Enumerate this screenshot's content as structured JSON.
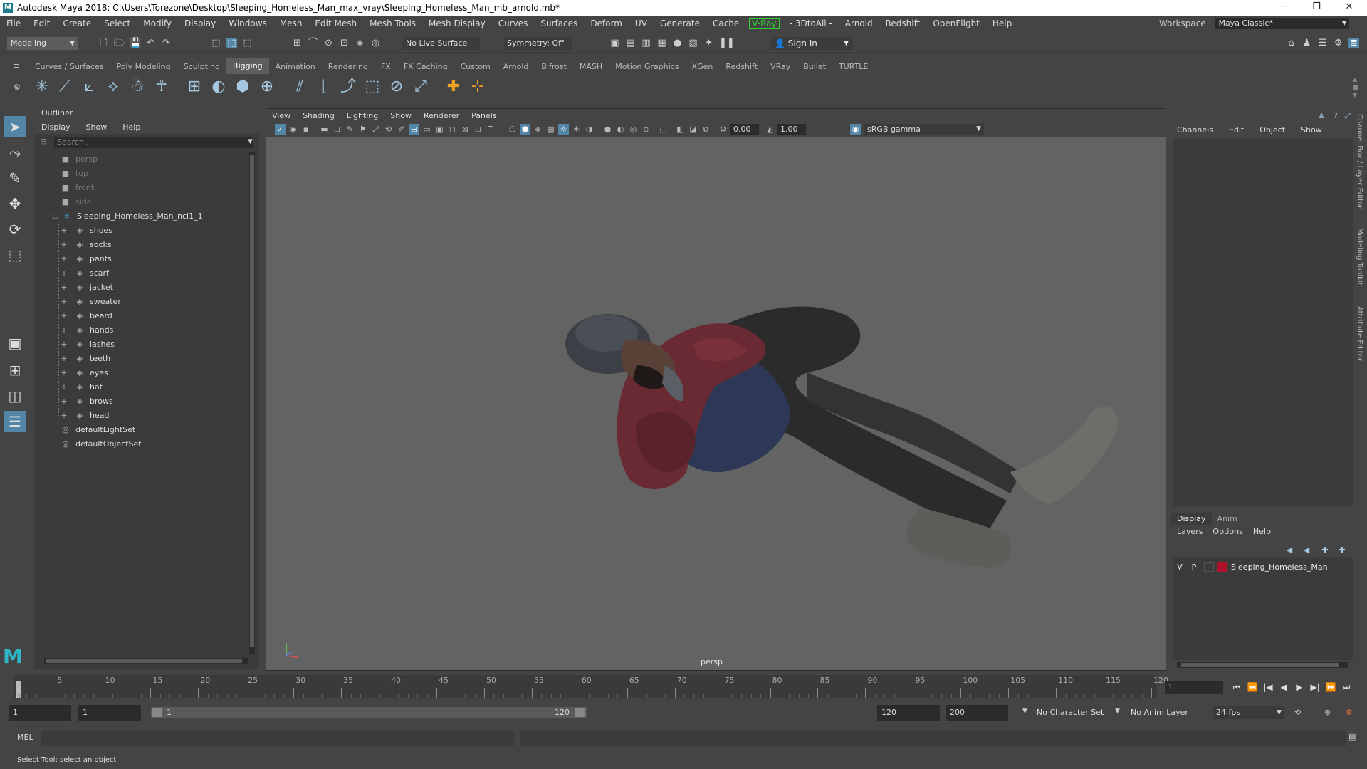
{
  "titlebar": {
    "title": "Autodesk Maya 2018: C:\\Users\\Torezone\\Desktop\\Sleeping_Homeless_Man_max_vray\\Sleeping_Homeless_Man_mb_arnold.mb*",
    "minimize": "─",
    "maximize": "❐",
    "close": "✕"
  },
  "menubar": {
    "items": [
      "File",
      "Edit",
      "Create",
      "Select",
      "Modify",
      "Display",
      "Windows",
      "Mesh",
      "Edit Mesh",
      "Mesh Tools",
      "Mesh Display",
      "Curves",
      "Surfaces",
      "Deform",
      "UV",
      "Generate",
      "Cache",
      "V-Ray",
      "- 3DtoAll -",
      "Arnold",
      "Redshift",
      "OpenFlight",
      "Help"
    ],
    "workspace_label": "Workspace :",
    "workspace_value": "Maya Classic*"
  },
  "statusline": {
    "mode": "Modeling",
    "live_surface": "No Live Surface",
    "symmetry": "Symmetry: Off",
    "sign_in": "Sign In"
  },
  "shelf": {
    "tabs": [
      "Curves / Surfaces",
      "Poly Modeling",
      "Sculpting",
      "Rigging",
      "Animation",
      "Rendering",
      "FX",
      "FX Caching",
      "Custom",
      "Arnold",
      "Bifrost",
      "MASH",
      "Motion Graphics",
      "XGen",
      "Redshift",
      "VRay",
      "Bullet",
      "TURTLE"
    ],
    "active_tab": "Rigging",
    "icon_names": [
      "joint-tool-icon",
      "ik-handle-icon",
      "ik-spline-icon",
      "insert-joint-icon",
      "quick-rig-icon",
      "hik-icon",
      "bind-skin-icon",
      "smooth-skin-icon",
      "lattice-icon",
      "cluster-icon",
      "wrap-icon",
      "orient-constraint-icon",
      "parent-constraint-icon",
      "point-constraint-icon",
      "scale-constraint-icon",
      "aim-constraint-icon",
      "pole-vector-icon",
      "locator-icon",
      "add-attribute-icon"
    ]
  },
  "outliner": {
    "title": "Outliner",
    "menu": [
      "Display",
      "Show",
      "Help"
    ],
    "search_placeholder": "Search...",
    "cameras": [
      "persp",
      "top",
      "front",
      "side"
    ],
    "group": "Sleeping_Homeless_Man_ncl1_1",
    "meshes": [
      "shoes",
      "socks",
      "pants",
      "scarf",
      "jacket",
      "sweater",
      "beard",
      "hands",
      "lashes",
      "teeth",
      "eyes",
      "hat",
      "brows",
      "head"
    ],
    "sets": [
      "defaultLightSet",
      "defaultObjectSet"
    ]
  },
  "viewport": {
    "menu": [
      "View",
      "Shading",
      "Lighting",
      "Show",
      "Renderer",
      "Panels"
    ],
    "exposure": "0.00",
    "gamma": "1.00",
    "color_space": "sRGB gamma",
    "camera_label": "persp"
  },
  "channelbox": {
    "menu": [
      "Channels",
      "Edit",
      "Object",
      "Show"
    ]
  },
  "side_tabs": [
    "Channel Box / Layer Editor",
    "Modeling Toolkit",
    "Attribute Editor"
  ],
  "layer_editor": {
    "tabs": [
      "Display",
      "Anim"
    ],
    "active_tab": "Display",
    "menu": [
      "Layers",
      "Options",
      "Help"
    ],
    "layer": {
      "visible": "V",
      "playback": "P",
      "name": "Sleeping_Homeless_Man",
      "color": "#b0122c"
    }
  },
  "timeslider": {
    "ticks": [
      "5",
      "10",
      "15",
      "20",
      "25",
      "30",
      "35",
      "40",
      "45",
      "50",
      "55",
      "60",
      "65",
      "70",
      "75",
      "80",
      "85",
      "90",
      "95",
      "100",
      "105",
      "110",
      "115",
      "120"
    ],
    "current_frame": "1",
    "frame_field": "1",
    "playback_buttons": [
      "⏮",
      "⏪",
      "|◀",
      "◀",
      "▶",
      "▶|",
      "⏩",
      "⏭"
    ]
  },
  "rangeslider": {
    "start": "1",
    "start2": "1",
    "range_start": "1",
    "range_end": "120",
    "end": "120",
    "end2": "200",
    "character_set": "No Character Set",
    "anim_layer": "No Anim Layer",
    "fps": "24 fps"
  },
  "cmdline": {
    "mel": "MEL",
    "help": "Select Tool: select an object"
  },
  "colors": {
    "accent": "#5285a6",
    "background": "#444444",
    "viewport": "#636363",
    "vray_green": "#2fd12f"
  }
}
